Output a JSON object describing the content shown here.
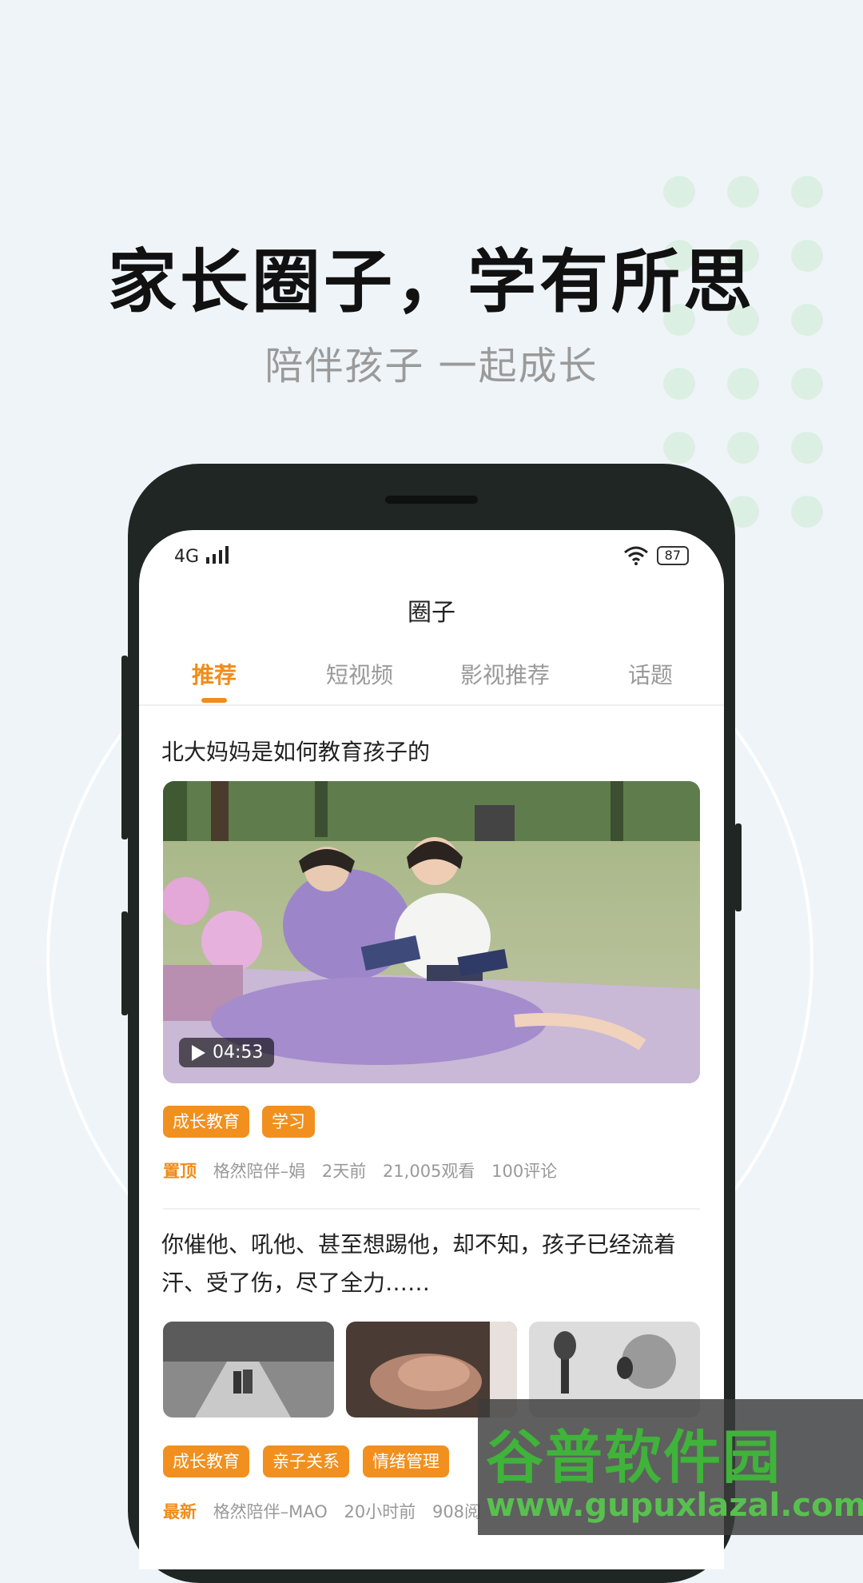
{
  "hero": {
    "headline": "家长圈子，学有所思",
    "subtitle": "陪伴孩子 一起成长"
  },
  "status_bar": {
    "network": "4G",
    "battery": "87"
  },
  "app": {
    "title": "圈子"
  },
  "tabs": [
    {
      "label": "推荐",
      "active": true
    },
    {
      "label": "短视频",
      "active": false
    },
    {
      "label": "影视推荐",
      "active": false
    },
    {
      "label": "话题",
      "active": false
    }
  ],
  "posts": [
    {
      "title": "北大妈妈是如何教育孩子的",
      "video_duration": "04:53",
      "tags": [
        "成长教育",
        "学习"
      ],
      "badge": "置顶",
      "author": "格然陪伴–娟",
      "time": "2天前",
      "views": "21,005观看",
      "comments": "100评论"
    },
    {
      "title": "你催他、吼他、甚至想踢他，却不知，孩子已经流着汗、受了伤，尽了全力……",
      "tags": [
        "成长教育",
        "亲子关系",
        "情绪管理"
      ],
      "badge": "最新",
      "author": "格然陪伴–MAO",
      "time": "20小时前",
      "views": "908阅"
    }
  ],
  "watermark": {
    "name": "谷普软件园",
    "url": "www.gupuxlazal.com"
  },
  "colors": {
    "accent": "#f18c1a",
    "tag_bg": "#f1901e",
    "background": "#eff4f8",
    "dots": "#dcefe3"
  }
}
